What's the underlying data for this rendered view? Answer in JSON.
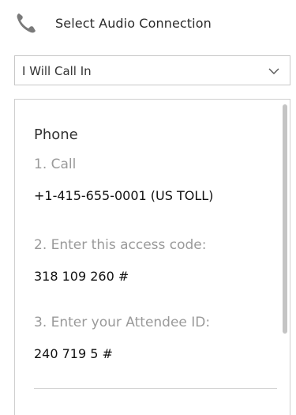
{
  "header": {
    "icon": "phone-icon",
    "title": "Select Audio Connection"
  },
  "audio_select": {
    "selected": "I Will Call In",
    "icon": "chevron-down-icon"
  },
  "dial_in": {
    "heading": "Phone",
    "step1_label": "1. Call",
    "phone_number": "+1-415-655-0001 (US TOLL)",
    "step2_label": "2. Enter this access code:",
    "access_code": "318 109 260 #",
    "step3_label": "3. Enter your Attendee ID:",
    "attendee_id": "240 719 5 #"
  },
  "colors": {
    "icon_gray": "#7a7a7a",
    "step_gray": "#9a9a9a",
    "border": "#c8c8c8"
  }
}
